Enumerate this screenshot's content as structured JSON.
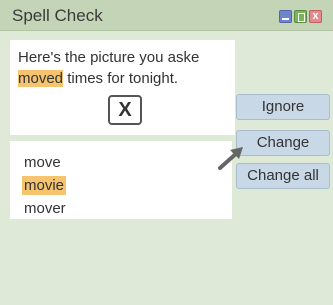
{
  "window": {
    "title": "Spell Check",
    "close_glyph": "x"
  },
  "document": {
    "line1": "Here's the picture you aske",
    "misspelled": "moved",
    "line2_rest": " times for tonight."
  },
  "dismiss_glyph": "X",
  "suggestions": [
    "move",
    "movie",
    "mover"
  ],
  "selected_suggestion": "movie",
  "buttons": {
    "ignore": "Ignore",
    "change": "Change",
    "change_all": "Change all"
  },
  "colors": {
    "highlight": "#f6c36e",
    "button": "#c8d8e6",
    "titlebar": "#c3d4b7"
  },
  "icons": [
    "minimize-icon",
    "maximize-icon",
    "close-icon",
    "arrow-icon"
  ]
}
